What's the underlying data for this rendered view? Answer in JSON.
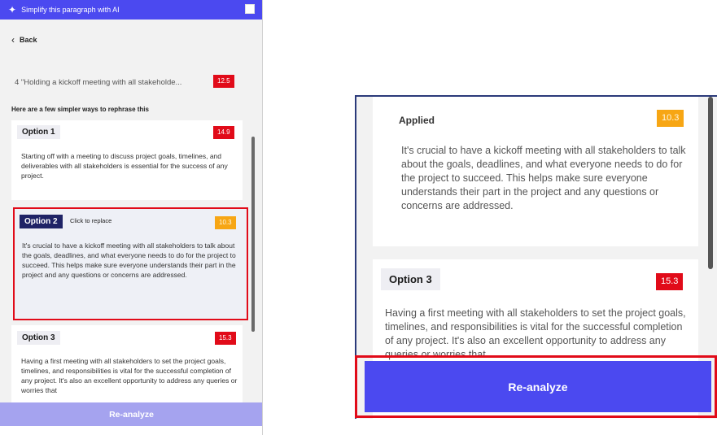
{
  "left_panel": {
    "title": "Simplify this paragraph with AI",
    "back_label": "Back",
    "original_text": "4 \"Holding a kickoff meeting with all stakeholde...",
    "original_score": "12.5",
    "section_heading": "Here are a few simpler ways to rephrase this",
    "options": [
      {
        "label": "Option 1",
        "score": "14.9",
        "text": "Starting off with a meeting to discuss project goals, timelines, and deliverables with all stakeholders is essential for the success of any project."
      },
      {
        "label": "Option 2",
        "hint": "Click to replace",
        "score": "10.3",
        "text": "It's crucial to have a kickoff meeting with all stakeholders to talk about the goals, deadlines, and what everyone needs to do for the project to succeed. This helps make sure everyone understands their part in the project and any questions or concerns are addressed."
      },
      {
        "label": "Option 3",
        "score": "15.3",
        "text": "Having a first meeting with all stakeholders to set the project goals, timelines, and responsibilities is vital for the successful completion of any project. It's also an excellent opportunity to address any queries or worries that"
      }
    ],
    "reanalyze_label": "Re-analyze"
  },
  "right_panel": {
    "applied_label": "Applied",
    "applied_score": "10.3",
    "applied_text": "It's crucial to have a kickoff meeting with all stakeholders to talk about the goals, deadlines, and what everyone needs to do for the project to succeed. This helps make sure everyone understands their part in the project and any questions or concerns are addressed.",
    "option3_label": "Option 3",
    "option3_score": "15.3",
    "option3_text": "Having a first meeting with all stakeholders to set the project goals, timelines, and responsibilities is vital for the successful completion of any project. It's also an excellent opportunity to address any queries or worries that",
    "reanalyze_label": "Re-analyze"
  },
  "icons": {
    "title_icon": "sparkle-icon",
    "back_icon": "chevron-left-icon"
  },
  "colors": {
    "accent": "#4b49f0",
    "score_red": "#e10b19",
    "score_orange": "#f7a614",
    "option_selected": "#1f2366",
    "highlight": "#e10b19"
  }
}
